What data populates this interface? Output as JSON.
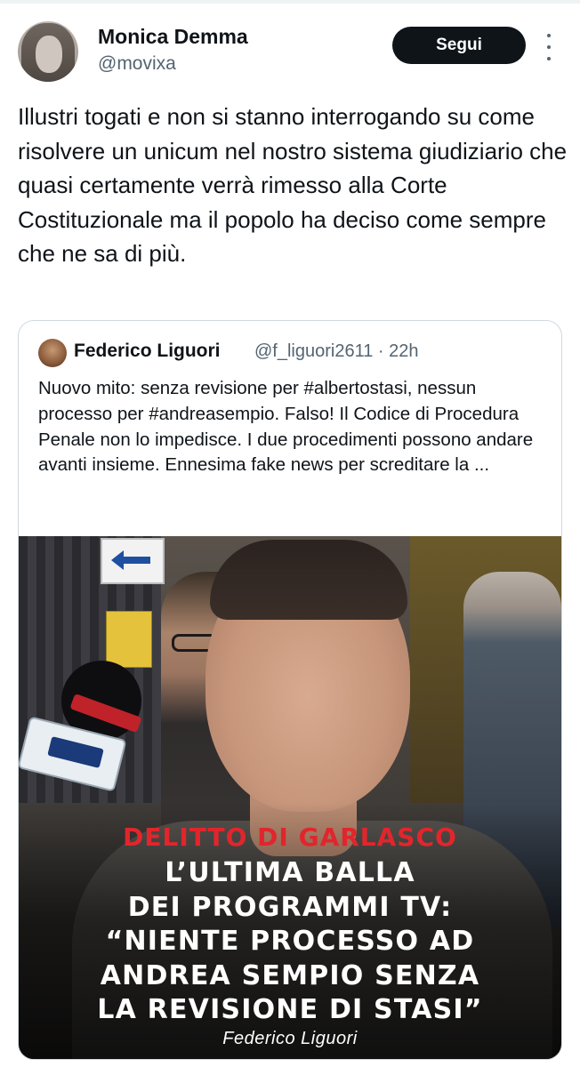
{
  "tweet": {
    "author": {
      "display_name": "Monica Demma",
      "handle": "@movixa"
    },
    "follow_label": "Segui",
    "text": "Illustri togati e non si stanno interrogando su come risolvere un unicum nel nostro sistema giudiziario che quasi certamente verrà rimesso alla Corte Costituzionale ma il popolo ha deciso come sempre che ne sa di più."
  },
  "quoted": {
    "author": {
      "display_name": "Federico Liguori",
      "handle": "@f_liguori2611",
      "time": "22h",
      "handle_time": "@f_liguori2611 · 22h"
    },
    "text": "Nuovo mito: senza revisione per #albertostasi, nessun processo per #andreasempio. Falso! Il Codice di Procedura Penale non lo impedisce. I due procedimenti possono andare avanti insieme. Ennesima fake news per screditare la ...",
    "media": {
      "headline_red": "DELITTO DI GARLASCO",
      "headline_lines": [
        "L’ULTIMA BALLA",
        "DEI PROGRAMMI TV:",
        "“NIENTE PROCESSO AD",
        "ANDREA SEMPIO SENZA",
        "LA REVISIONE DI STASI”"
      ],
      "byline": "Federico Liguori"
    }
  },
  "colors": {
    "text_primary": "#0f1419",
    "text_secondary": "#536471",
    "follow_bg": "#0f1419",
    "border": "#cfd9de",
    "headline_red": "#e0262c"
  },
  "icons": {
    "more": "more-vertical-icon"
  }
}
